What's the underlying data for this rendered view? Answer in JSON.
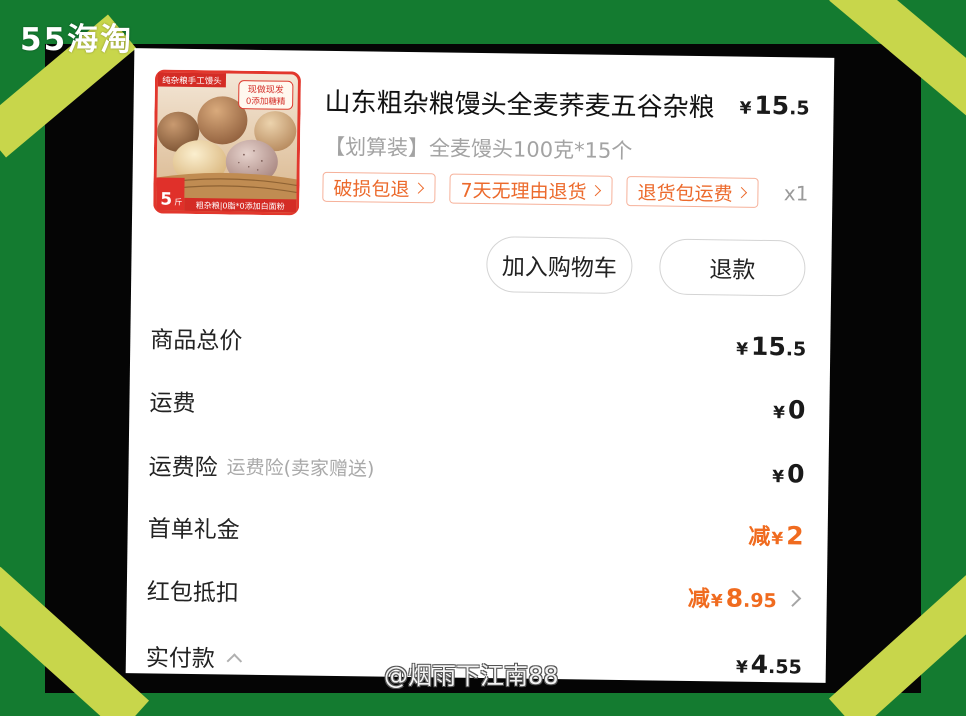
{
  "watermarks": {
    "top_left": "55海淘",
    "bottom": "@烟雨下江南88"
  },
  "product": {
    "title": "山东粗杂粮馒头全麦荞麦五谷杂粮",
    "price": "¥15.5",
    "spec": "【划算装】全麦馒头100克*15个",
    "quantity": "x1",
    "tags": [
      {
        "label": "破损包退",
        "icon": "chevron-right-icon"
      },
      {
        "label": "7天无理由退货",
        "icon": "chevron-right-icon"
      },
      {
        "label": "退货包运费",
        "icon": "chevron-right-icon"
      }
    ],
    "image": {
      "top_tag": "纯杂粮手工馒头",
      "badge_line1": "现做现发",
      "badge_line2": "0添加糖精",
      "weight_number": "5",
      "weight_unit": "斤",
      "bottom_bar": "粗杂粮|0脂*0添加白面粉"
    }
  },
  "actions": {
    "add_to_cart": "加入购物车",
    "refund": "退款"
  },
  "summary": [
    {
      "label": "商品总价",
      "value": "¥15.5"
    },
    {
      "label": "运费",
      "value": "¥0"
    },
    {
      "label": "运费险",
      "note": "运费险(卖家赠送)",
      "value": "¥0"
    },
    {
      "label": "首单礼金",
      "value": "减¥2"
    },
    {
      "label": "红包抵扣",
      "value": "减¥8.95",
      "icon": "chevron-right-icon"
    },
    {
      "label": "实付款",
      "value": "¥4.55",
      "icon": "chevron-up-icon"
    }
  ],
  "colors": {
    "background_green": "#147b30",
    "tape_yellow": "#c8d64b",
    "discount_orange": "#f06b1f",
    "tag_text": "#ec6a2c",
    "tag_border": "#f6b19a"
  }
}
